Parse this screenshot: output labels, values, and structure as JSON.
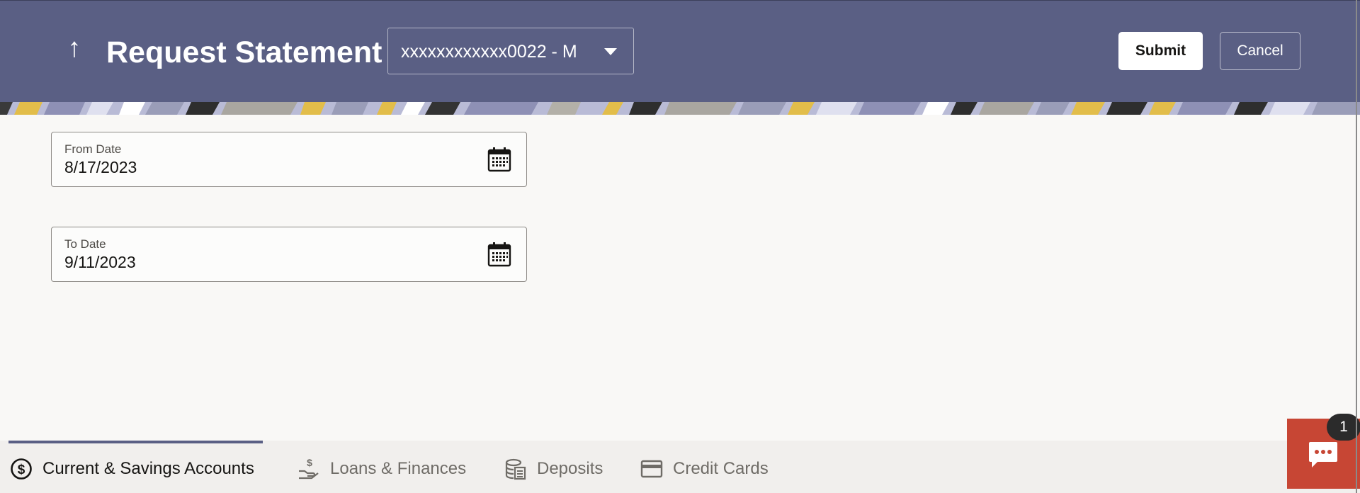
{
  "header": {
    "title": "Request Statement",
    "account": "xxxxxxxxxxxx0022 - M",
    "submit_label": "Submit",
    "cancel_label": "Cancel",
    "header_color": "#5a5f84"
  },
  "form": {
    "from_date": {
      "label": "From Date",
      "value": "8/17/2023"
    },
    "to_date": {
      "label": "To Date",
      "value": "9/11/2023"
    }
  },
  "tabs": [
    {
      "label": "Current & Savings Accounts",
      "icon": "dollar-circle-icon",
      "active": true
    },
    {
      "label": "Loans & Finances",
      "icon": "hand-money-icon",
      "active": false
    },
    {
      "label": "Deposits",
      "icon": "deposit-stack-icon",
      "active": false
    },
    {
      "label": "Credit Cards",
      "icon": "credit-card-icon",
      "active": false
    }
  ],
  "chat": {
    "badge_count": "1",
    "icon": "chat-bubble-icon",
    "color": "#c74634"
  }
}
